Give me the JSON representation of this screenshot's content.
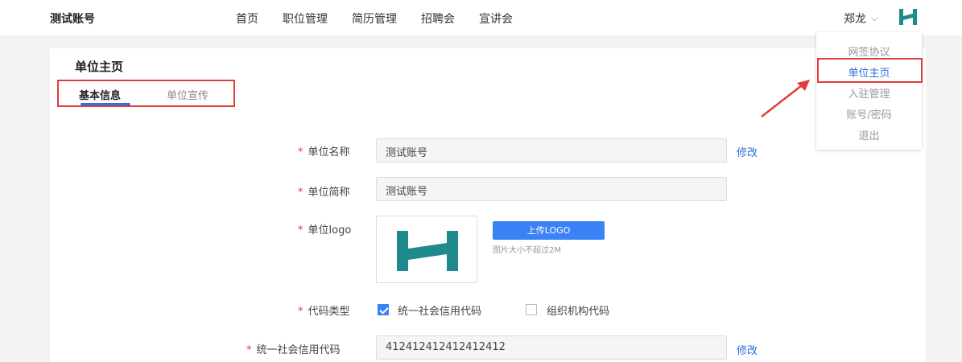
{
  "header": {
    "brand": "测试账号",
    "nav": [
      "首页",
      "职位管理",
      "简历管理",
      "招聘会",
      "宣讲会"
    ],
    "user_name": "郑龙",
    "user_chevron": "⌵"
  },
  "card": {
    "title": "单位主页",
    "tabs": [
      {
        "label": "基本信息",
        "active": true
      },
      {
        "label": "单位宣传",
        "active": false
      }
    ]
  },
  "form": {
    "required_mark": "*",
    "name_label": "单位名称",
    "name_value": "测试账号",
    "name_edit": "修改",
    "short_label": "单位简称",
    "short_value": "测试账号",
    "logo_label": "单位logo",
    "upload_button": "上传LOGO",
    "upload_hint": "图片大小不超过2M",
    "code_type_label": "代码类型",
    "code_type_options": [
      {
        "label": "统一社会信用代码",
        "checked": true
      },
      {
        "label": "组织机构代码",
        "checked": false
      }
    ],
    "credit_code_label": "统一社会信用代码",
    "credit_code_value": "412412412412412412",
    "credit_code_edit": "修改"
  },
  "dropdown": {
    "items": [
      "网签协议",
      "单位主页",
      "入驻管理",
      "账号/密码",
      "退出"
    ],
    "active_index": 1
  },
  "colors": {
    "accent": "#2a6fdb",
    "highlight": "#e23b3b",
    "logo": "#1f8a8c"
  }
}
